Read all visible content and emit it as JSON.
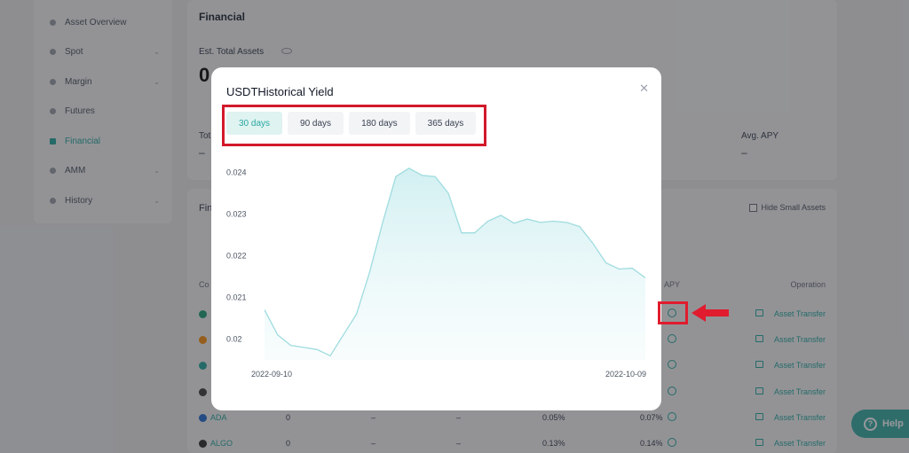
{
  "sidebar": {
    "items": [
      {
        "label": "Asset Overview",
        "chevron": false
      },
      {
        "label": "Spot",
        "chevron": true
      },
      {
        "label": "Margin",
        "chevron": true
      },
      {
        "label": "Futures",
        "chevron": false
      },
      {
        "label": "Financial",
        "chevron": false,
        "active": true
      },
      {
        "label": "AMM",
        "chevron": true
      },
      {
        "label": "History",
        "chevron": true
      }
    ]
  },
  "financial_panel": {
    "title": "Financial",
    "est_total_label": "Est. Total Assets",
    "est_total_value": "0",
    "total_label": "Tot",
    "total_value": "–",
    "avg_apy_label": "Avg. APY",
    "avg_apy_value": "–"
  },
  "list_panel": {
    "title": "Fin",
    "hide_small_label": "Hide Small Assets",
    "col_coin": "Co",
    "col_apy": "APY",
    "col_operation": "Operation",
    "rows": [
      {
        "coin": "",
        "c1": "",
        "c2": "",
        "c3": "",
        "c4": "",
        "c5": "",
        "action": "Asset Transfer",
        "color": "#26a17b"
      },
      {
        "coin": "",
        "c1": "",
        "c2": "",
        "c3": "",
        "c4": "",
        "c5": "",
        "action": "Asset Transfer",
        "color": "#f7931a"
      },
      {
        "coin": "",
        "c1": "",
        "c2": "",
        "c3": "",
        "c4": "",
        "c5": "",
        "action": "Asset Transfer",
        "color": "#2aa8a0"
      },
      {
        "coin": "",
        "c1": "",
        "c2": "",
        "c3": "",
        "c4": "",
        "c5": "",
        "action": "Asset Transfer",
        "color": "#444"
      },
      {
        "coin": "ADA",
        "c1": "0",
        "c2": "–",
        "c3": "–",
        "c4": "0.05%",
        "c5": "0.07%",
        "action": "Asset Transfer",
        "color": "#2a71d0"
      },
      {
        "coin": "ALGO",
        "c1": "0",
        "c2": "–",
        "c3": "–",
        "c4": "0.13%",
        "c5": "0.14%",
        "action": "Asset Transfer",
        "color": "#333"
      }
    ]
  },
  "modal": {
    "title": "USDTHistorical Yield",
    "close_icon": "close-icon",
    "tabs": [
      {
        "label": "30 days",
        "active": true
      },
      {
        "label": "90 days",
        "active": false
      },
      {
        "label": "180 days",
        "active": false
      },
      {
        "label": "365 days",
        "active": false
      }
    ]
  },
  "help": {
    "label": "Help"
  },
  "colors": {
    "accent": "#2aa8a0",
    "annotation_red": "#d3192b",
    "line": "#9fdcdf"
  },
  "chart_data": {
    "type": "area",
    "x_start_label": "2022-09-10",
    "x_end_label": "2022-10-09",
    "y_ticks": [
      0.02,
      0.021,
      0.022,
      0.023,
      0.024
    ],
    "ylim": [
      0.0195,
      0.0245
    ],
    "values": [
      0.0207,
      0.0201,
      0.01985,
      0.0198,
      0.01975,
      0.0196,
      0.0201,
      0.0206,
      0.0216,
      0.0228,
      0.0239,
      0.0241,
      0.02393,
      0.0239,
      0.0235,
      0.02255,
      0.02255,
      0.02283,
      0.02297,
      0.02278,
      0.02288,
      0.0228,
      0.02283,
      0.0228,
      0.0227,
      0.0223,
      0.02183,
      0.02168,
      0.0217,
      0.02147
    ]
  }
}
